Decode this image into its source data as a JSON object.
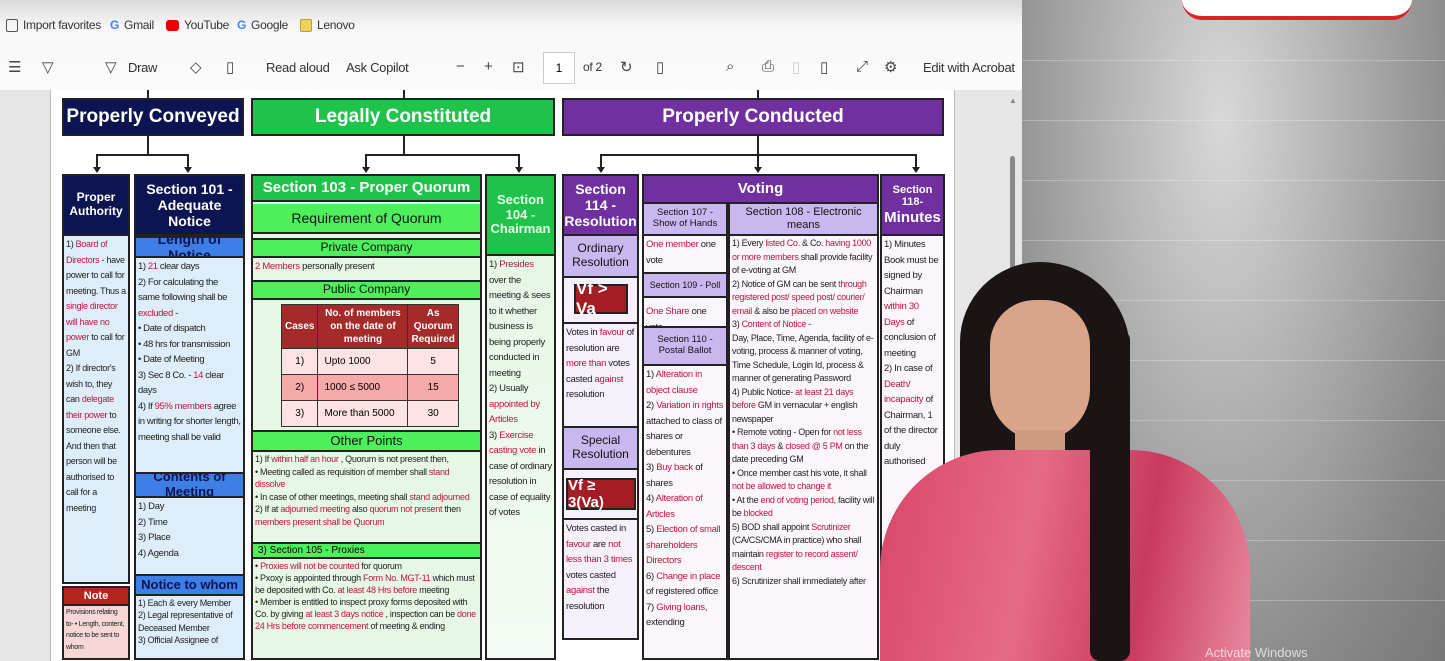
{
  "favorites": [
    "Import favorites",
    "Gmail",
    "YouTube",
    "Google",
    "Lenovo"
  ],
  "toolbar": {
    "draw": "Draw",
    "read_aloud": "Read aloud",
    "ask_copilot": "Ask Copilot",
    "page_current": "1",
    "page_total": "of 2",
    "edit": "Edit with Acrobat"
  },
  "icons": [
    "list-icon",
    "highlighter-icon",
    "draw-icon",
    "eraser-icon",
    "text-box-icon",
    "zoom-out-icon",
    "zoom-in-icon",
    "fit-page-icon",
    "rotate-icon",
    "page-view-icon",
    "search-icon",
    "print-icon",
    "save-icon",
    "save-as-icon",
    "fullscreen-icon",
    "settings-icon"
  ],
  "colors": {
    "navy": "#0d1452",
    "green": "#1fc24a",
    "light_green": "#4cf05a",
    "purple": "#7030a0",
    "lavender": "#c9b8f0",
    "blue": "#2f6fe0",
    "red_text": "#c0143c",
    "formula": "#a41d24"
  },
  "top": {
    "conveyed": "Properly Conveyed",
    "constituted": "Legally Constituted",
    "conducted": "Properly Conducted"
  },
  "authority": {
    "title": "Proper Authority",
    "body": [
      [
        {
          "t": "1) "
        },
        {
          "t": "Board of Directors",
          "hl": 1
        },
        {
          "t": " - have power to call for meeting. Thus a "
        },
        {
          "t": "single director will have no power",
          "hl": 1
        },
        {
          "t": " to call for GM"
        }
      ],
      [
        {
          "t": "2) If director's wish to, they can "
        },
        {
          "t": "delegate their power",
          "hl": 1
        },
        {
          "t": " to someone else. And then that person will be authorised to call for a meeting"
        }
      ]
    ],
    "note_title": "Note",
    "note_body": [
      [
        {
          "t": "Provisions relating to- • Length, content, notice to be sent to whom"
        }
      ]
    ]
  },
  "s101": {
    "title": "Section 101 - Adequate Notice",
    "length_title": "Length of Notice",
    "length": [
      [
        {
          "t": "1) "
        },
        {
          "t": "21",
          "hl": 1
        },
        {
          "t": " clear days"
        }
      ],
      [
        {
          "t": "2) For calculating the same following shall be "
        },
        {
          "t": "excluded",
          "hl": 1
        },
        {
          "t": " -"
        }
      ],
      [
        {
          "t": "• Date of dispatch"
        }
      ],
      [
        {
          "t": "• 48 hrs for transmission"
        }
      ],
      [
        {
          "t": "• Date of Meeting"
        }
      ],
      [
        {
          "t": "3) Sec 8 Co. - "
        },
        {
          "t": "14",
          "hl": 1
        },
        {
          "t": " clear days"
        }
      ],
      [
        {
          "t": "4) If "
        },
        {
          "t": "95% members",
          "hl": 1
        },
        {
          "t": " agree in writing for shorter length, meeting shall be valid"
        }
      ]
    ],
    "contents_title": "Contents of Meeting",
    "contents": [
      [
        {
          "t": "1) Day"
        }
      ],
      [
        {
          "t": "2) Time"
        }
      ],
      [
        {
          "t": "3) Place"
        }
      ],
      [
        {
          "t": "4) Agenda"
        }
      ]
    ],
    "whom_title": "Notice to whom",
    "whom": [
      [
        {
          "t": "1) Each & every Member"
        }
      ],
      [
        {
          "t": "2) Legal representative of Deceased Member"
        }
      ],
      [
        {
          "t": "3) Official Assignee of"
        }
      ]
    ]
  },
  "s103": {
    "title": "Section 103 - Proper Quorum",
    "req": "Requirement of Quorum",
    "private": "Private Company",
    "private_body": [
      [
        {
          "t": "2 Members",
          "hl": 1
        },
        {
          "t": " personally present"
        }
      ]
    ],
    "public": "Public Company",
    "table": {
      "headers": [
        "Cases",
        "No. of members on the date of meeting",
        "As Quorum Required"
      ],
      "rows": [
        [
          "1)",
          "Upto 1000",
          "5"
        ],
        [
          "2)",
          "1000 ≤ 5000",
          "15"
        ],
        [
          "3)",
          "More than 5000",
          "30"
        ]
      ]
    },
    "other_title": "Other Points",
    "other": [
      [
        {
          "t": "1) If "
        },
        {
          "t": "within half an hour",
          "hl": 1
        },
        {
          "t": " , Quorum is not present then,"
        }
      ],
      [
        {
          "t": "• Meeting called as requisition of member shall "
        },
        {
          "t": "stand dissolve",
          "hl": 1
        }
      ],
      [
        {
          "t": "• In case of other meetings, meeting shall "
        },
        {
          "t": "stand adjourned",
          "hl": 1
        }
      ],
      [
        {
          "t": "2) If at "
        },
        {
          "t": "adjourned meeting",
          "hl": 1
        },
        {
          "t": " also "
        },
        {
          "t": "quorum not present",
          "hl": 1
        },
        {
          "t": " then "
        },
        {
          "t": "members present shall be Quorum",
          "hl": 1
        }
      ]
    ],
    "proxies_title": "3) Section 105 - Proxies",
    "proxies": [
      [
        {
          "t": "• "
        },
        {
          "t": "Proxies will not be counted",
          "hl": 1
        },
        {
          "t": " for quorum"
        }
      ],
      [
        {
          "t": "• Pxoxy is appointed through "
        },
        {
          "t": "Form No. MGT-11",
          "hl": 1
        },
        {
          "t": " which must be deposited with Co. "
        },
        {
          "t": "at least 48 Hrs before",
          "hl": 1
        },
        {
          "t": " meeting"
        }
      ],
      [
        {
          "t": "• Member is entitled to inspect proxy forms deposited with Co. by giving "
        },
        {
          "t": "at least 3 days notice",
          "hl": 1
        },
        {
          "t": " , inspection can be "
        },
        {
          "t": "done 24 Hrs before commencement",
          "hl": 1
        },
        {
          "t": " of meeting & ending"
        }
      ]
    ]
  },
  "s104": {
    "title": "Section 104 - Chairman",
    "body": [
      [
        {
          "t": "1) "
        },
        {
          "t": "Presides",
          "hl": 1
        },
        {
          "t": " over the meeting & sees to it whether business is being properly conducted in meeting"
        }
      ],
      [
        {
          "t": "2) Usually "
        },
        {
          "t": "appointed by Articles",
          "hl": 1
        }
      ],
      [
        {
          "t": "3) "
        },
        {
          "t": "Exercise casting vote",
          "hl": 1
        },
        {
          "t": " in case of ordinary resolution in case of equality of votes"
        }
      ]
    ]
  },
  "s114": {
    "title": "Section 114 - Resolution",
    "ordinary": "Ordinary Resolution",
    "ordinary_formula": "Vf > Va",
    "ordinary_body": [
      [
        {
          "t": "Votes in "
        },
        {
          "t": "favour",
          "hl": 1
        },
        {
          "t": " of resolution are "
        },
        {
          "t": "more than",
          "hl": 1
        },
        {
          "t": " votes casted "
        },
        {
          "t": "against",
          "hl": 1
        },
        {
          "t": " resolution"
        }
      ]
    ],
    "special": "Special Resolution",
    "special_formula": "Vf ≥ 3(Va)",
    "special_body": [
      [
        {
          "t": "Votes casted in "
        },
        {
          "t": "favour",
          "hl": 1
        },
        {
          "t": " are "
        },
        {
          "t": "not less than 3 times",
          "hl": 1
        },
        {
          "t": " votes casted "
        },
        {
          "t": "against",
          "hl": 1
        },
        {
          "t": " the resolution"
        }
      ]
    ]
  },
  "voting": {
    "title": "Voting",
    "s107": "Section 107 - Show of Hands",
    "s107_body": [
      [
        {
          "t": "One member",
          "hl": 1
        },
        {
          "t": " one vote"
        }
      ]
    ],
    "s109": "Section 109 - Poll",
    "s109_body": [
      [
        {
          "t": "One Share",
          "hl": 1
        },
        {
          "t": " one vote"
        }
      ]
    ],
    "s110": "Section 110 - Postal Ballot",
    "s110_body": [
      [
        {
          "t": "1) "
        },
        {
          "t": "Alteration in object clause",
          "hl": 1
        }
      ],
      [
        {
          "t": "2) "
        },
        {
          "t": "Variation in rights",
          "hl": 1
        },
        {
          "t": " attached to class of shares or debentures"
        }
      ],
      [
        {
          "t": "3) "
        },
        {
          "t": "Buy back",
          "hl": 1
        },
        {
          "t": " of shares"
        }
      ],
      [
        {
          "t": "4) "
        },
        {
          "t": "Alteration of Articles",
          "hl": 1
        }
      ],
      [
        {
          "t": "5) "
        },
        {
          "t": "Election of small shareholders Directors",
          "hl": 1
        }
      ],
      [
        {
          "t": "6) "
        },
        {
          "t": "Change in place",
          "hl": 1
        },
        {
          "t": " of registered office"
        }
      ],
      [
        {
          "t": "7) "
        },
        {
          "t": "Giving loans,",
          "hl": 1
        },
        {
          "t": " extending"
        }
      ]
    ],
    "s108": "Section 108 - Electronic means",
    "s108_body": [
      [
        {
          "t": "1) Every "
        },
        {
          "t": "listed Co.",
          "hl": 1
        },
        {
          "t": " & Co. "
        },
        {
          "t": "having 1000 or more members",
          "hl": 1
        },
        {
          "t": " shall provide facility of e-voting at GM"
        }
      ],
      [
        {
          "t": "2) Notice of GM can be sent "
        },
        {
          "t": "through registered post/ speed post/ courier/ email",
          "hl": 1
        },
        {
          "t": " & also be "
        },
        {
          "t": "placed on website",
          "hl": 1
        }
      ],
      [
        {
          "t": "3) "
        },
        {
          "t": "Content of Notice",
          "hl": 1
        },
        {
          "t": " -"
        }
      ],
      [
        {
          "t": "Day, Place, Time, Agenda, facility of e-voting, process & manner of voting, Time Schedule, Login Id, process & manner of generating Password"
        }
      ],
      [
        {
          "t": "4) Public Notice- "
        },
        {
          "t": "at least 21 days before",
          "hl": 1
        },
        {
          "t": " GM in vernacular + english newspaper"
        }
      ],
      [
        {
          "t": "• Remote voting - Open for "
        },
        {
          "t": "not less than 3 days",
          "hl": 1
        },
        {
          "t": " & "
        },
        {
          "t": "closed @ 5 PM",
          "hl": 1
        },
        {
          "t": " on the date preceding GM"
        }
      ],
      [
        {
          "t": "• Once member cast his vote, it shall "
        },
        {
          "t": "not be allowed to change it",
          "hl": 1
        }
      ],
      [
        {
          "t": "• At the "
        },
        {
          "t": "end of voting period,",
          "hl": 1
        },
        {
          "t": " facility will be "
        },
        {
          "t": "blocked",
          "hl": 1
        }
      ],
      [
        {
          "t": "5) BOD shall appoint "
        },
        {
          "t": "Scrutinizer",
          "hl": 1
        },
        {
          "t": " (CA/CS/CMA in practice) who shall maintain "
        },
        {
          "t": "register to record assent/ descent",
          "hl": 1
        }
      ],
      [
        {
          "t": "6) Scrutinizer shall immediately after"
        }
      ]
    ]
  },
  "s118": {
    "title_a": "Section 118-",
    "title_b": "Minutes",
    "body": [
      [
        {
          "t": "1) Minutes Book must be signed by Chairman "
        },
        {
          "t": "within 30 Days",
          "hl": 1
        },
        {
          "t": " of conclusion of meeting"
        }
      ],
      [
        {
          "t": "2) In case of "
        },
        {
          "t": "Death/ incapacity",
          "hl": 1
        },
        {
          "t": " of Chairman, 1 of the director duly authorised"
        }
      ]
    ]
  },
  "watermark_notice": "Activate Windows"
}
